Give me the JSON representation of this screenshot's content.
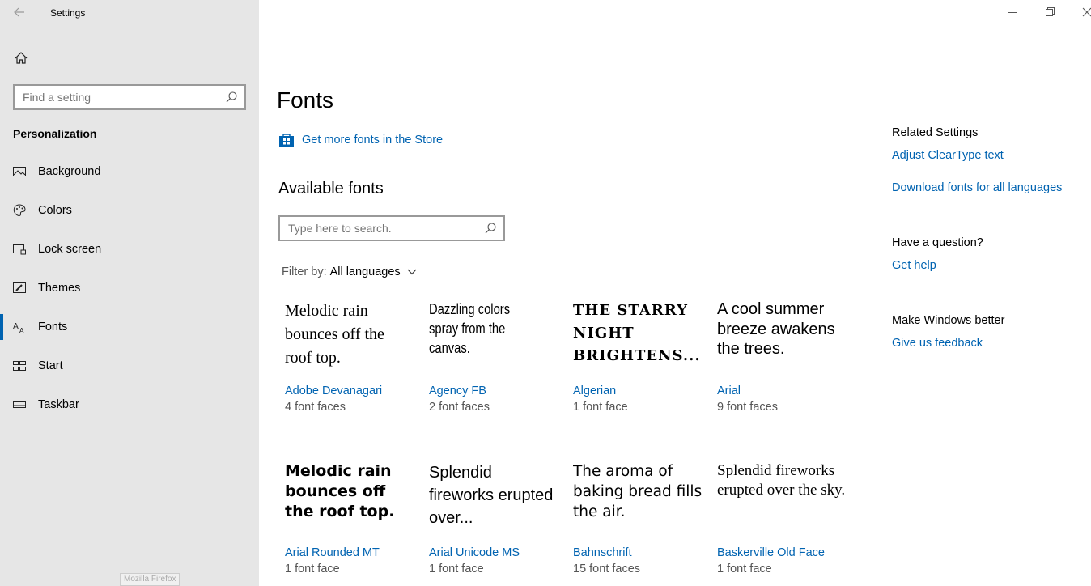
{
  "app": {
    "title": "Settings"
  },
  "sidebar": {
    "search_placeholder": "Find a setting",
    "section": "Personalization",
    "items": [
      {
        "label": "Background",
        "icon": "picture-icon"
      },
      {
        "label": "Colors",
        "icon": "palette-icon"
      },
      {
        "label": "Lock screen",
        "icon": "lock-screen-icon"
      },
      {
        "label": "Themes",
        "icon": "brush-icon"
      },
      {
        "label": "Fonts",
        "icon": "fonts-icon",
        "active": true
      },
      {
        "label": "Start",
        "icon": "start-icon"
      },
      {
        "label": "Taskbar",
        "icon": "taskbar-icon"
      }
    ]
  },
  "tooltip": {
    "text": "Mozilla Firefox"
  },
  "main": {
    "title": "Fonts",
    "store_link": "Get more fonts in the Store",
    "available_title": "Available fonts",
    "search_placeholder": "Type here to search.",
    "filter_label": "Filter by:",
    "filter_value": "All languages",
    "fonts": [
      {
        "preview": "Melodic rain bounces off the roof top.",
        "name": "Adobe Devanagari",
        "faces": "4 font faces"
      },
      {
        "preview": "Dazzling colors spray from the canvas.",
        "name": "Agency FB",
        "faces": "2 font faces"
      },
      {
        "preview": "THE STARRY NIGHT BRIGHTENS...",
        "name": "Algerian",
        "faces": "1 font face"
      },
      {
        "preview": "A cool summer breeze awakens the trees.",
        "name": "Arial",
        "faces": "9 font faces"
      },
      {
        "preview": "Melodic rain bounces off the roof top.",
        "name": "Arial Rounded MT",
        "faces": "1 font face"
      },
      {
        "preview": "Splendid fireworks erupted over...",
        "name": "Arial Unicode MS",
        "faces": "1 font face"
      },
      {
        "preview": "The aroma of baking bread fills the air.",
        "name": "Bahnschrift",
        "faces": "15 font faces"
      },
      {
        "preview": "Splendid fireworks erupted over the sky.",
        "name": "Baskerville Old Face",
        "faces": "1 font face"
      }
    ]
  },
  "related": {
    "heading": "Related Settings",
    "cleartype": "Adjust ClearType text",
    "download": "Download fonts for all languages",
    "question": "Have a question?",
    "help": "Get help",
    "better": "Make Windows better",
    "feedback": "Give us feedback"
  },
  "colors": {
    "accent": "#0063b1",
    "sidebar_bg": "#e6e6e6"
  }
}
